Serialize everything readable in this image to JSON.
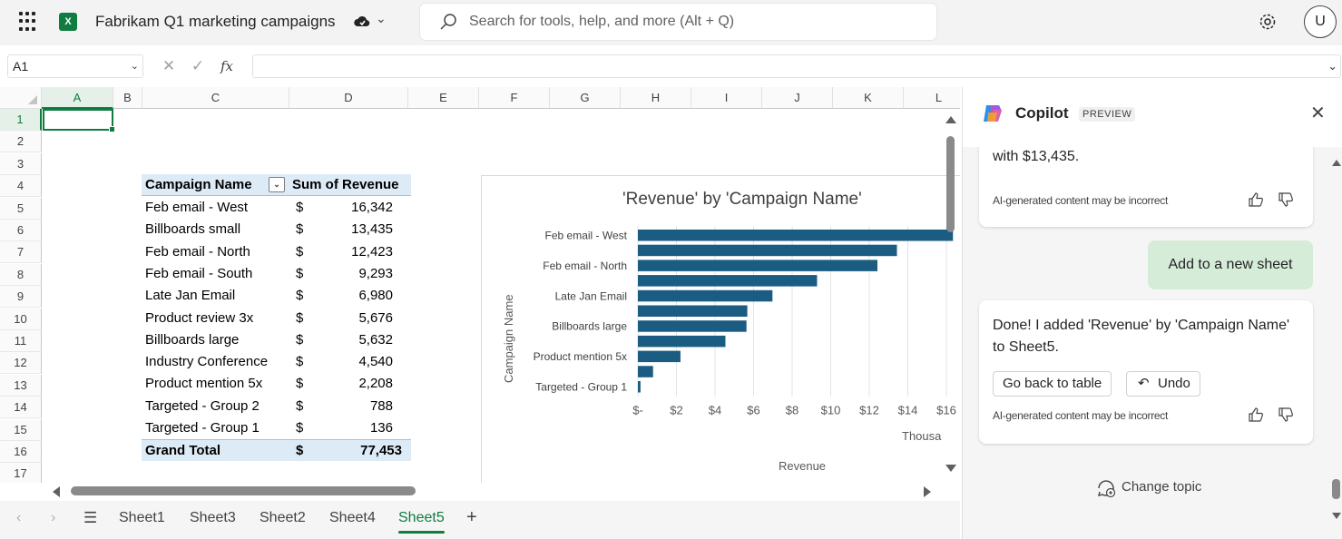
{
  "titlebar": {
    "doc_title": "Fabrikam Q1 marketing campaigns",
    "search_placeholder": "Search for tools, help, and more (Alt + Q)",
    "avatar_initial": "U"
  },
  "formula": {
    "name_box": "A1",
    "fx_label": "fx",
    "value": ""
  },
  "grid": {
    "columns": [
      "A",
      "B",
      "C",
      "D",
      "E",
      "F",
      "G",
      "H",
      "I",
      "J",
      "K",
      "L"
    ],
    "rows": [
      "1",
      "2",
      "3",
      "4",
      "5",
      "6",
      "7",
      "8",
      "9",
      "10",
      "11",
      "12",
      "13",
      "14",
      "15",
      "16",
      "17"
    ],
    "selected_cell": "A1"
  },
  "pivot": {
    "header_name": "Campaign Name",
    "header_sum": "Sum of Revenue",
    "currency": "$",
    "rows": [
      {
        "name": "Feb email - West",
        "value": "16,342"
      },
      {
        "name": "Billboards small",
        "value": "13,435"
      },
      {
        "name": "Feb email - North",
        "value": "12,423"
      },
      {
        "name": "Feb email - South",
        "value": "9,293"
      },
      {
        "name": "Late Jan Email",
        "value": "6,980"
      },
      {
        "name": "Product review 3x",
        "value": "5,676"
      },
      {
        "name": "Billboards large",
        "value": "5,632"
      },
      {
        "name": "Industry Conference",
        "value": "4,540"
      },
      {
        "name": "Product mention 5x",
        "value": "2,208"
      },
      {
        "name": "Targeted - Group 2",
        "value": "788"
      },
      {
        "name": "Targeted - Group 1",
        "value": "136"
      }
    ],
    "total_label": "Grand Total",
    "total_value": "77,453"
  },
  "chart_data": {
    "type": "bar",
    "orientation": "horizontal",
    "title": "'Revenue' by 'Campaign Name'",
    "xlabel": "Revenue",
    "ylabel": "Campaign Name",
    "x_units": "Thousa",
    "categories": [
      "Feb email - West",
      "Billboards small",
      "Feb email - North",
      "Feb email - South",
      "Late Jan Email",
      "Product review 3x",
      "Billboards large",
      "Industry Conference",
      "Product mention 5x",
      "Targeted - Group 2",
      "Targeted - Group 1"
    ],
    "visible_category_labels": [
      "Feb email - West",
      "Feb email - North",
      "Late Jan Email",
      "Billboards large",
      "Product mention 5x",
      "Targeted - Group 1"
    ],
    "values": [
      16342,
      13435,
      12423,
      9293,
      6980,
      5676,
      5632,
      4540,
      2208,
      788,
      136
    ],
    "x_ticks": [
      "$-",
      "$2",
      "$4",
      "$6",
      "$8",
      "$10",
      "$12",
      "$14",
      "$16"
    ],
    "xlim": [
      0,
      16000
    ],
    "bar_color": "#1b5c82",
    "grid": true,
    "legend": "none"
  },
  "sheets": {
    "tabs": [
      "Sheet1",
      "Sheet3",
      "Sheet2",
      "Sheet4",
      "Sheet5"
    ],
    "active": "Sheet5",
    "add_label": "+"
  },
  "copilot": {
    "title": "Copilot",
    "badge": "PREVIEW",
    "card1_text": "with $13,435.",
    "disclaimer": "AI-generated content may be incorrect",
    "user_message": "Add to a new sheet",
    "card2_text": "Done! I added 'Revenue' by 'Campaign Name' to Sheet5.",
    "go_back_label": "Go back to table",
    "undo_label": "Undo",
    "change_topic_label": "Change topic"
  },
  "colors": {
    "excel_green": "#107c41",
    "pivot_header_bg": "#ddebf7",
    "user_bubble": "#d5ecd9",
    "bar": "#1b5c82"
  }
}
